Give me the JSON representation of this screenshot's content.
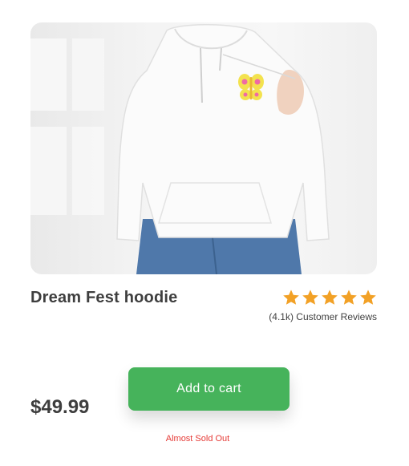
{
  "product": {
    "name": "Dream Fest hoodie",
    "rating_stars": 5,
    "reviews_text": "(4.1k) Customer Reviews",
    "price": "$49.99",
    "stock_status": "Almost Sold Out"
  },
  "actions": {
    "add_to_cart_label": "Add to cart"
  },
  "image": {
    "icon": "hoodie-photo"
  },
  "colors": {
    "accent_green": "#46b35b",
    "star_orange": "#f2a126",
    "warning_red": "#e53935"
  }
}
